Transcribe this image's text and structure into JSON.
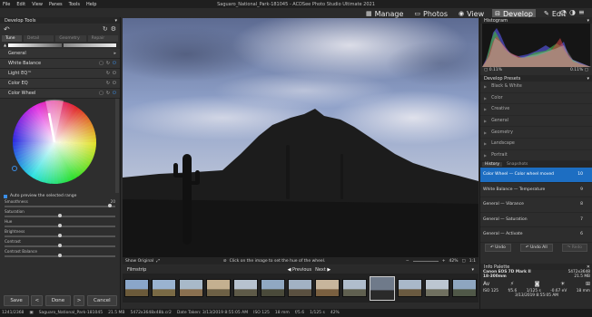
{
  "menu": [
    "File",
    "Edit",
    "View",
    "Panes",
    "Tools",
    "Help"
  ],
  "window_title": "Saguaro_National_Park-181045 - ACDSee Photo Studio Ultimate 2021",
  "modes": [
    {
      "label": "Manage",
      "icon": "manage-icon",
      "active": false
    },
    {
      "label": "Photos",
      "icon": "photos-icon",
      "active": false
    },
    {
      "label": "View",
      "icon": "view-icon",
      "active": false
    },
    {
      "label": "Develop",
      "icon": "develop-icon",
      "active": true
    },
    {
      "label": "Edit",
      "icon": "edit-icon",
      "active": false
    }
  ],
  "left_panel": {
    "title": "Develop Tools",
    "tabs": [
      "Tune",
      "Detail",
      "Geometry",
      "Repair"
    ],
    "sections": [
      {
        "label": "General"
      },
      {
        "label": "White Balance"
      },
      {
        "label": "Light EQ™"
      },
      {
        "label": "Color EQ"
      },
      {
        "label": "Color Wheel"
      }
    ],
    "auto_preview_label": "Auto preview the selected range",
    "smoothness_label": "Smoothness",
    "smoothness_value": "20",
    "smoothness_fraction": 0.95,
    "sliders": [
      {
        "label": "Saturation",
        "value": "",
        "fraction": 0.5
      },
      {
        "label": "Hue",
        "value": "",
        "fraction": 0.5
      },
      {
        "label": "Brightness",
        "value": "",
        "fraction": 0.5
      },
      {
        "label": "Contrast",
        "value": "",
        "fraction": 0.5
      },
      {
        "label": "Contrast Balance",
        "value": "",
        "fraction": 0.5
      }
    ],
    "buttons": {
      "save": "Save",
      "done": "Done",
      "cancel": "Cancel"
    }
  },
  "image_bar": {
    "show_original": "Show Original",
    "hint": "Click on the image to set the hue of the wheel.",
    "zoom": "42%"
  },
  "filmstrip": {
    "title": "Filmstrip",
    "previous": "Previous",
    "next": "Next",
    "thumb_count": 13,
    "selected_index": 9
  },
  "right_panel": {
    "histogram_title": "Histogram",
    "hist_left": "0.11%",
    "hist_right": "0.11%",
    "presets_title": "Develop Presets",
    "presets": [
      "Black & White",
      "Color",
      "Creative",
      "General",
      "Geometry",
      "Landscape",
      "Portrait"
    ],
    "history_tabs": [
      "History",
      "Snapshots"
    ],
    "history": [
      {
        "label": "Color Wheel — Color wheel moved",
        "num": "10",
        "selected": true
      },
      {
        "label": "White Balance — Temperature",
        "num": "9",
        "selected": false
      },
      {
        "label": "General — Vibrance",
        "num": "8",
        "selected": false
      },
      {
        "label": "General — Saturation",
        "num": "7",
        "selected": false
      },
      {
        "label": "General — Activate",
        "num": "6",
        "selected": false
      }
    ],
    "undo": "Undo",
    "undo_all": "Undo All",
    "redo": "Redo",
    "info_title": "Info Palette",
    "camera": "Canon EOS 7D Mark II",
    "dims": "5472x3648",
    "lens": "18-300mm",
    "size": "21.5 MB",
    "iso": "ISO 125",
    "aperture": "f/5.6",
    "shutter": "1/125 s",
    "ev": "-0.67 eV",
    "focal": "18 mm",
    "date": "3/13/2019 8:55:05 AM"
  },
  "status_bar": {
    "index": "1241/2368",
    "file": "Saguaro_National_Park-181045",
    "size": "21.5 MB",
    "dims": "5472x3648x48b.cr2",
    "date": "Date Taken: 3/13/2019 8:55:05 AM",
    "iso": "ISO 125",
    "focal": "18 mm",
    "ap": "f/5.6",
    "shutter": "1/125 s",
    "zoom": "42%"
  },
  "colors": {
    "accent": "#1d6ec2",
    "bg": "#2b2b2b"
  }
}
